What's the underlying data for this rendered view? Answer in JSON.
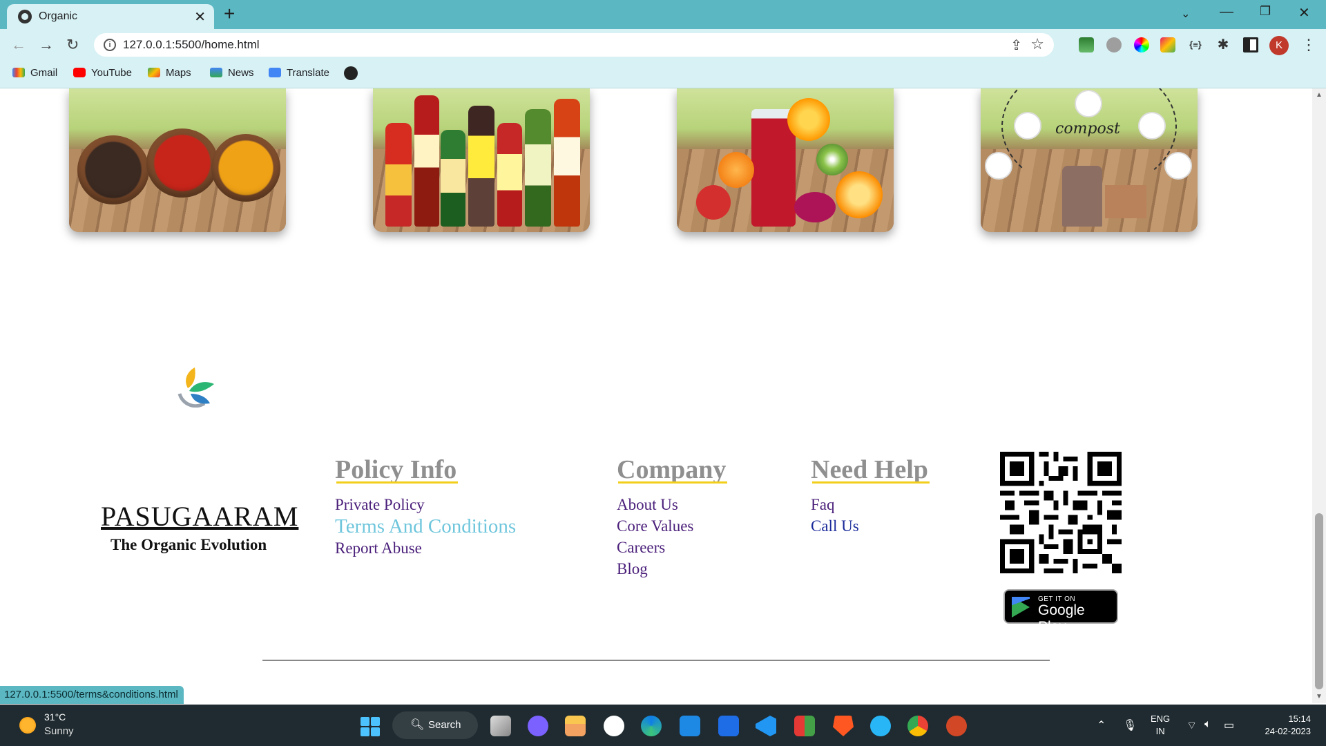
{
  "browser": {
    "tab_title": "Organic",
    "url": "127.0.0.1:5500/home.html",
    "profile_initial": "K",
    "bookmarks": [
      "Gmail",
      "YouTube",
      "Maps",
      "News",
      "Translate"
    ],
    "status_url": "127.0.0.1:5500/terms&conditions.html"
  },
  "products": [
    {
      "name": "spices-image"
    },
    {
      "name": "sauces-image"
    },
    {
      "name": "juices-image"
    },
    {
      "name": "compost-image",
      "label": "compost"
    }
  ],
  "footer": {
    "brand": "PASUGAARAM",
    "tagline": "The Organic Evolution",
    "policy": {
      "title": "Policy Info",
      "links": [
        "Private Policy",
        "Terms And Conditions",
        "Report Abuse"
      ]
    },
    "company": {
      "title": "Company",
      "links": [
        "About Us",
        "Core Values",
        "Careers",
        "Blog"
      ]
    },
    "help": {
      "title": "Need Help",
      "links": [
        "Faq",
        "Call Us"
      ]
    },
    "google_play": {
      "small": "GET IT ON",
      "big": "Google Play"
    }
  },
  "taskbar": {
    "temperature": "31°C",
    "condition": "Sunny",
    "search_label": "Search",
    "language": "ENG",
    "region": "IN",
    "time": "15:14",
    "date": "24-02-2023"
  },
  "colors": {
    "chrome": "#5bb8c3",
    "chrome_light": "#d7f1f5",
    "link": "#4a1f7a",
    "link_hover": "#6fc6dc",
    "title_underline": "#f2cf1a"
  }
}
